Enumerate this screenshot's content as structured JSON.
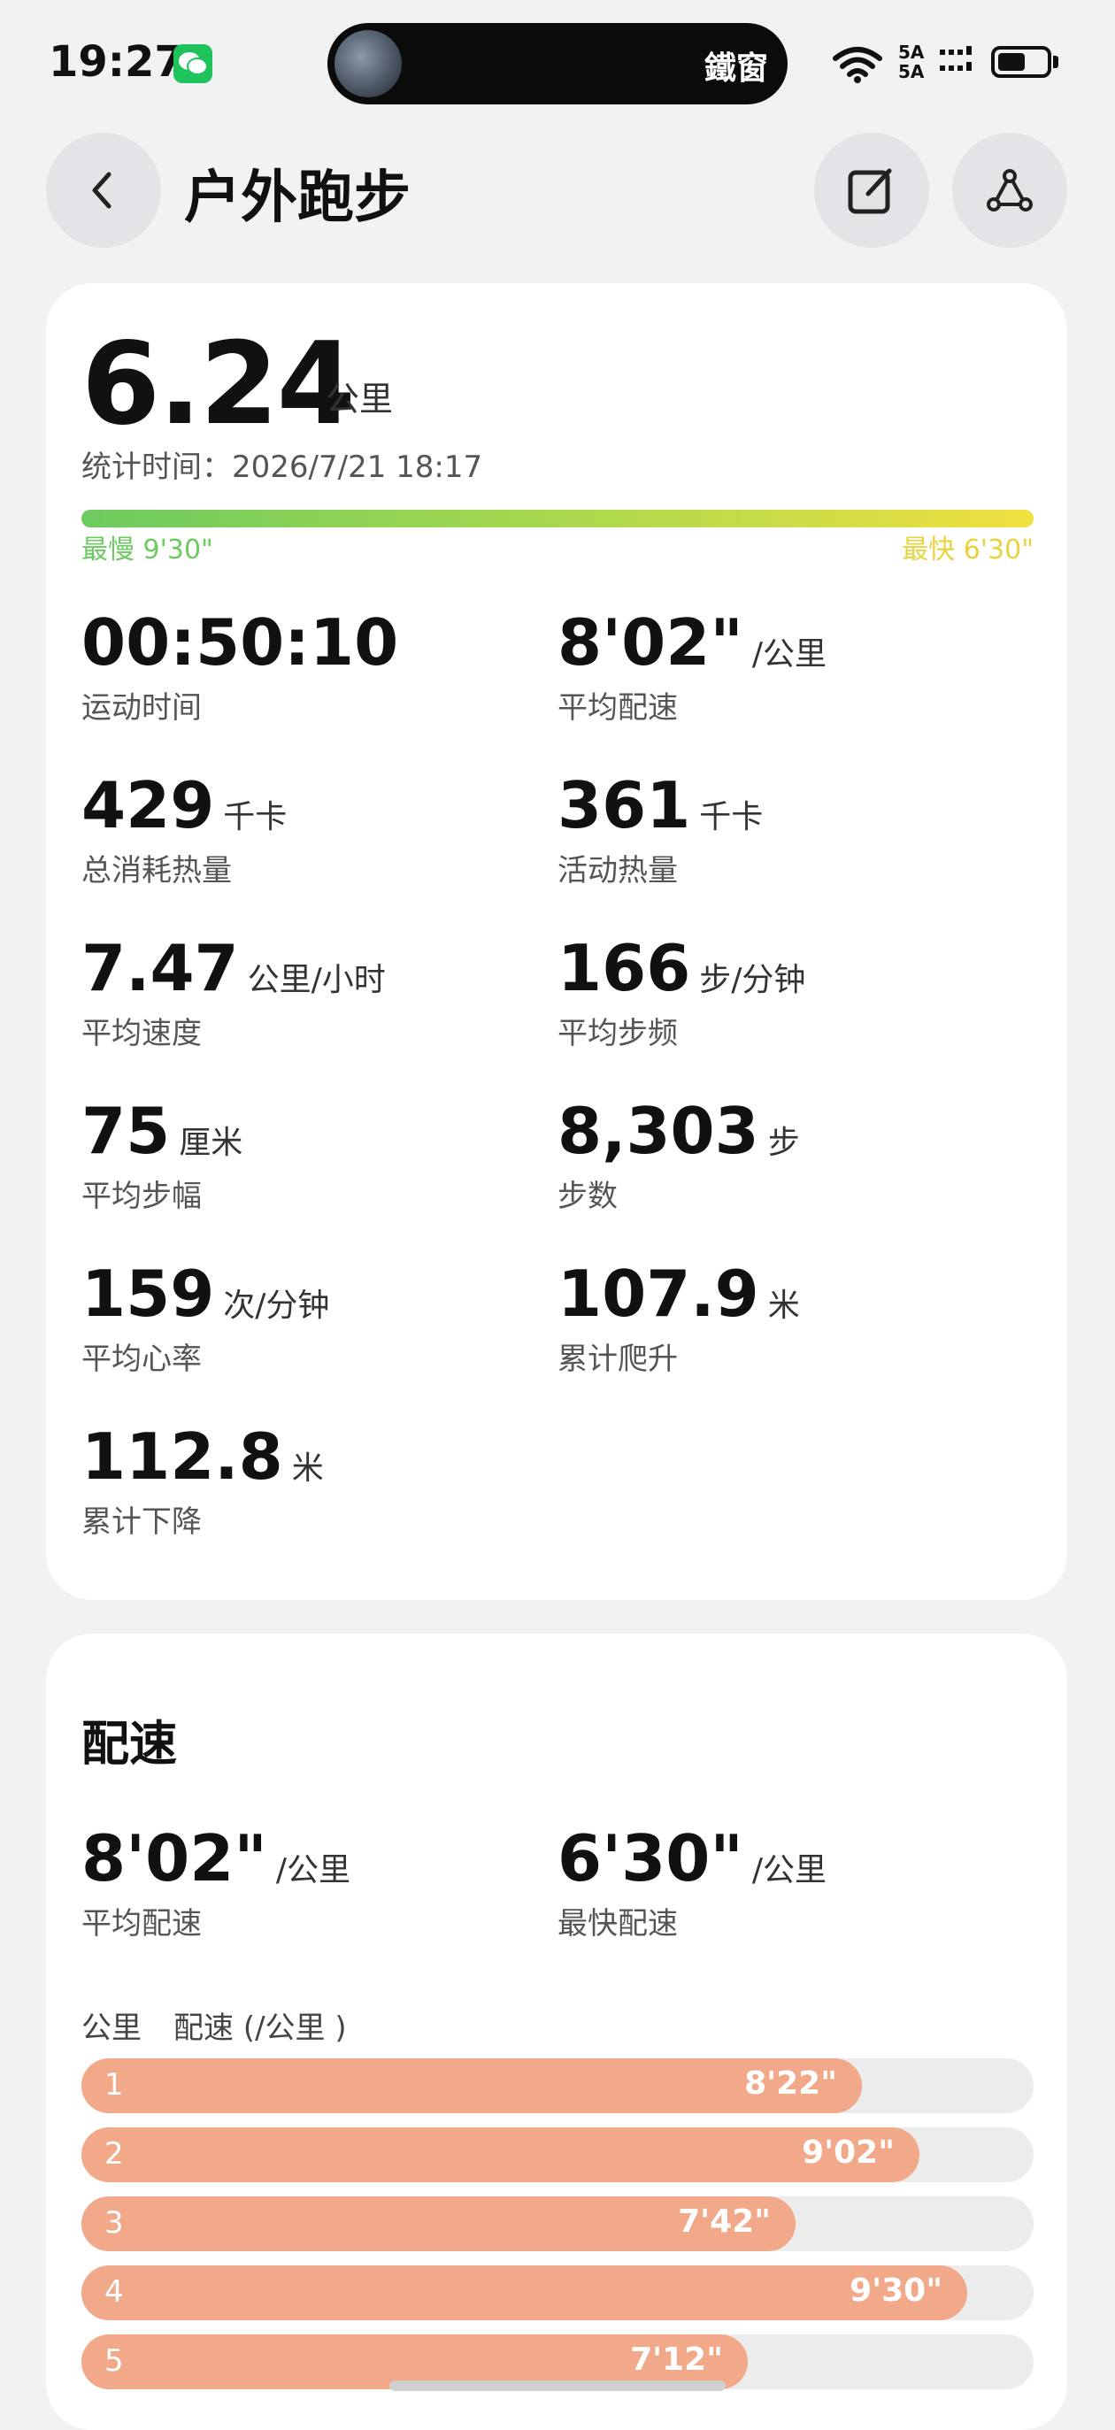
{
  "status_bar": {
    "time": "19:27",
    "island_text": "鐵窗",
    "signal_label_1": "5A",
    "signal_label_2": "5A"
  },
  "header": {
    "title": "户外跑步"
  },
  "summary": {
    "distance": "6.24",
    "distance_unit": "公里",
    "stat_time": "统计时间：2026/7/21 18:17",
    "slowest": "最慢 9'30\"",
    "fastest": "最快 6'30\"",
    "metrics": [
      {
        "value": "00:50:10",
        "unit": "",
        "label": "运动时间"
      },
      {
        "value": "8'02\"",
        "unit": "/公里",
        "label": "平均配速"
      },
      {
        "value": "429",
        "unit": "千卡",
        "label": "总消耗热量"
      },
      {
        "value": "361",
        "unit": "千卡",
        "label": "活动热量"
      },
      {
        "value": "7.47",
        "unit": "公里/小时",
        "label": "平均速度"
      },
      {
        "value": "166",
        "unit": "步/分钟",
        "label": "平均步频"
      },
      {
        "value": "75",
        "unit": "厘米",
        "label": "平均步幅"
      },
      {
        "value": "8,303",
        "unit": "步",
        "label": "步数"
      },
      {
        "value": "159",
        "unit": "次/分钟",
        "label": "平均心率"
      },
      {
        "value": "107.9",
        "unit": "米",
        "label": "累计爬升"
      },
      {
        "value": "112.8",
        "unit": "米",
        "label": "累计下降"
      }
    ]
  },
  "pace": {
    "title": "配速",
    "avg_value": "8'02\"",
    "avg_unit": "/公里",
    "avg_label": "平均配速",
    "best_value": "6'30\"",
    "best_unit": "/公里",
    "best_label": "最快配速",
    "col_km": "公里",
    "col_pace": "配速 (/公里 )",
    "splits": [
      {
        "km": "1",
        "pace": "8'22\"",
        "fraction": 0.82
      },
      {
        "km": "2",
        "pace": "9'02\"",
        "fraction": 0.88
      },
      {
        "km": "3",
        "pace": "7'42\"",
        "fraction": 0.75
      },
      {
        "km": "4",
        "pace": "9'30\"",
        "fraction": 0.93
      },
      {
        "km": "5",
        "pace": "7'12\"",
        "fraction": 0.7
      }
    ]
  },
  "colors": {
    "gradient_start": "#6ccb5f",
    "gradient_end": "#f1e040",
    "bar_fill": "#f2a98a"
  }
}
